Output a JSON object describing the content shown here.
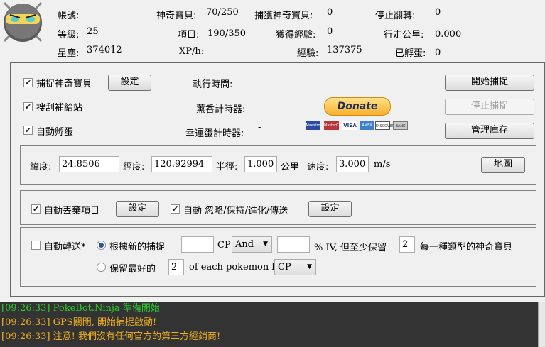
{
  "stats": {
    "account_label": "帳號:",
    "account_value": "",
    "level_label": "等級:",
    "level_value": "25",
    "stardust_label": "星塵:",
    "stardust_value": "374012",
    "pokemon_label": "神奇寶貝:",
    "pokemon_value": "70/250",
    "items_label": "項目:",
    "items_value": "190/350",
    "xph_label": "XP/h:",
    "xph_value": "",
    "caught_label": "捕獲神奇寶貝:",
    "caught_value": "0",
    "gained_xp_label": "獲得經驗:",
    "gained_xp_value": "0",
    "xp_label": "經驗:",
    "xp_value": "137375",
    "stops_label": "停止翻轉:",
    "stops_value": "0",
    "km_label": "行走公里:",
    "km_value": "0.000",
    "hatched_label": "已孵蛋:",
    "hatched_value": "0"
  },
  "controls": {
    "catch_label": "捕捉神奇寶貝",
    "catch_checked": true,
    "settings_label": "設定",
    "pokestop_label": "搜刮補給站",
    "pokestop_checked": true,
    "hatch_label": "自動孵蛋",
    "hatch_checked": true,
    "runtime_label": "執行時間:",
    "runtime_value": "",
    "incense_label": "薰香計時器:",
    "incense_value": "-",
    "lucky_egg_label": "幸運蛋計時器:",
    "lucky_egg_value": "-",
    "donate_label": "Donate",
    "cards": [
      "Maestro",
      "MasterCard",
      "VISA",
      "AMEX",
      "DISCOVER",
      "BANK"
    ],
    "start_label": "開始捕捉",
    "stop_label": "停止捕捉",
    "inventory_label": "管理庫存"
  },
  "location": {
    "lat_label": "緯度:",
    "lat_value": "24.8506",
    "lng_label": "經度:",
    "lng_value": "120.92994",
    "radius_label": "半徑:",
    "radius_value": "1.000",
    "radius_unit": "公里",
    "speed_label": "速度:",
    "speed_value": "3.000",
    "speed_unit": "m/s",
    "map_label": "地圖"
  },
  "auto": {
    "discard_label": "自動丟棄項目",
    "discard_checked": true,
    "discard_settings": "設定",
    "evolve_label": "自動 忽略/保持/進化/傳送",
    "evolve_checked": true,
    "evolve_settings": "設定"
  },
  "transfer": {
    "label": "自動轉送*",
    "checked": false,
    "by_new_label": "根據新的捕捉",
    "cp_value": "",
    "cp_label": "CP",
    "op_value": "And",
    "iv_value": "",
    "iv_label": "% IV, 但至少保留",
    "keep_min": "2",
    "each_type_label": "每一種類型的神奇寶貝",
    "keep_best_label": "保留最好的",
    "keep_best_value": "2",
    "of_each_label": "of each pokemon by",
    "by_value": "CP"
  },
  "log": [
    {
      "time": "[09:26:33]",
      "text": "PokeBot.Ninja 準備開始",
      "color": "#2ecc2e"
    },
    {
      "time": "[09:26:33]",
      "text": "GPS關閉, 開始捕捉啟動!",
      "color": "#f0b020"
    },
    {
      "time": "[09:26:33]",
      "text": "注意! 我們沒有任何官方的第三方經銷商!",
      "color": "#f0b020"
    }
  ]
}
